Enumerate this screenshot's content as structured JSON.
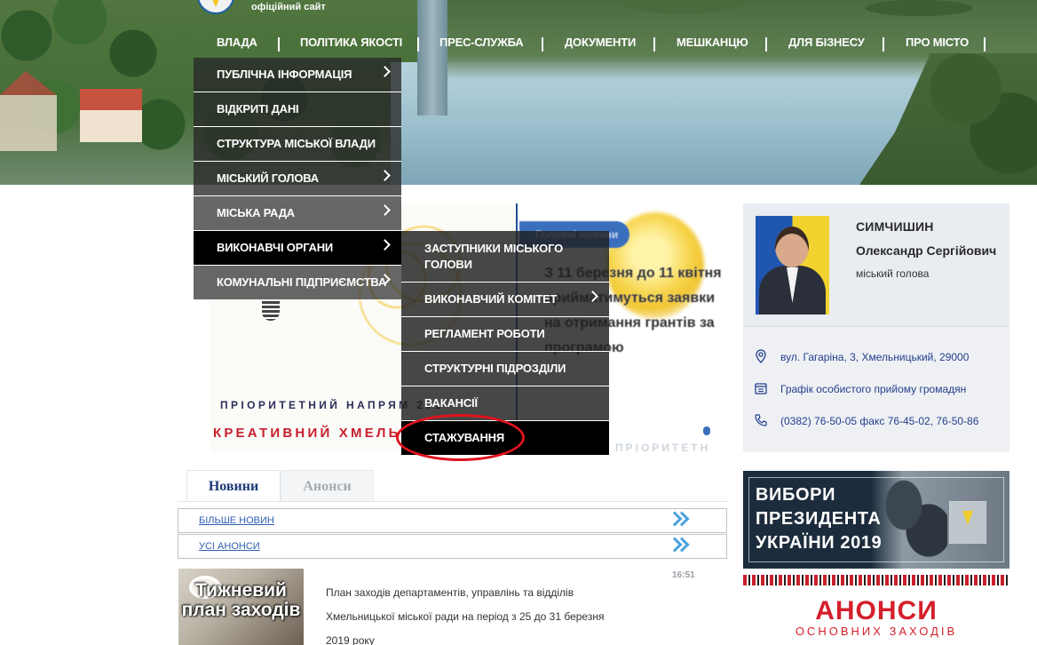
{
  "header": {
    "official_label": "офіційний сайт"
  },
  "nav": [
    "ВЛАДА",
    "ПОЛІТИКА ЯКОСТІ",
    "ПРЕС-СЛУЖБА",
    "ДОКУМЕНТИ",
    "МЕШКАНЦЮ",
    "ДЛЯ БІЗНЕСУ",
    "ПРО МІСТО"
  ],
  "menu_level1": [
    {
      "label": "ПУБЛІЧНА ІНФОРМАЦІЯ",
      "has_submenu": true
    },
    {
      "label": "ВІДКРИТІ ДАНІ",
      "has_submenu": false
    },
    {
      "label": "СТРУКТУРА МІСЬКОЇ ВЛАДИ",
      "has_submenu": false
    },
    {
      "label": "МІСЬКИЙ ГОЛОВА",
      "has_submenu": true
    },
    {
      "label": "МІСЬКА РАДА",
      "has_submenu": true
    },
    {
      "label": "ВИКОНАВЧІ ОРГАНИ",
      "has_submenu": true,
      "active": true
    },
    {
      "label": "КОМУНАЛЬНІ ПІДПРИЄМСТВА",
      "has_submenu": true
    }
  ],
  "menu_level2": [
    {
      "label": "ЗАСТУПНИКИ МІСЬКОГО ГОЛОВИ",
      "has_submenu": false
    },
    {
      "label": "ВИКОНАВЧИЙ КОМІТЕТ",
      "has_submenu": true
    },
    {
      "label": "РЕГЛАМЕНТ РОБОТИ",
      "has_submenu": false
    },
    {
      "label": "СТРУКТУРНІ ПІДРОЗДІЛИ",
      "has_submenu": false
    },
    {
      "label": "ВАКАНСІЇ",
      "has_submenu": false
    },
    {
      "label": "СТАЖУВАННЯ",
      "has_submenu": false,
      "highlighted": true
    }
  ],
  "slider": {
    "left_tagline": "ПРІОРИТЕТНИЙ НАПРЯМ 201",
    "left_title": "КРЕАТИВНИЙ ХМЕЛЬ",
    "badge": "Головні новини",
    "title": "З 11 березня до 11 квітня прийматимуться заявки на отримання грантів за програмою",
    "bottom_text": "ПРІОРИТЕТН"
  },
  "mayor": {
    "surname": "СИМЧИШИН",
    "name": "Олександр Сергійович",
    "role": "міський голова",
    "address": "вул. Гагаріна, 3, Хмельницький, 29000",
    "reception": "Графік особистого прийому громадян",
    "phones": "(0382) 76-50-05 факс 76-45-02, 76-50-86"
  },
  "banners": {
    "elections": "ВИБОРИ ПРЕЗИДЕНТА УКРАЇНИ 2019",
    "elections_lines": [
      "ВИБОРИ",
      "ПРЕЗИДЕНТА",
      "УКРАЇНИ 2019"
    ],
    "anonsy_big": "АНОНСИ",
    "anonsy_small": "ОСНОВНИХ ЗАХОДІВ"
  },
  "news": {
    "tabs": [
      "Новини",
      "Анонси"
    ],
    "more_news": "БІЛЬШЕ НОВИН",
    "all_announcements": "УСІ АНОНСИ",
    "item": {
      "thumb_text": "Тижневий план заходів",
      "time": "16:51",
      "title": "План заходів департаментів, управлінь та відділів Хмельницької міської ради на період з 25 до 31 березня 2019 року"
    }
  },
  "colors": {
    "accent_blue": "#3a6fbd",
    "link_blue": "#2f5fb4",
    "highlight_red": "#e0131d",
    "menu_active": "#000000"
  }
}
